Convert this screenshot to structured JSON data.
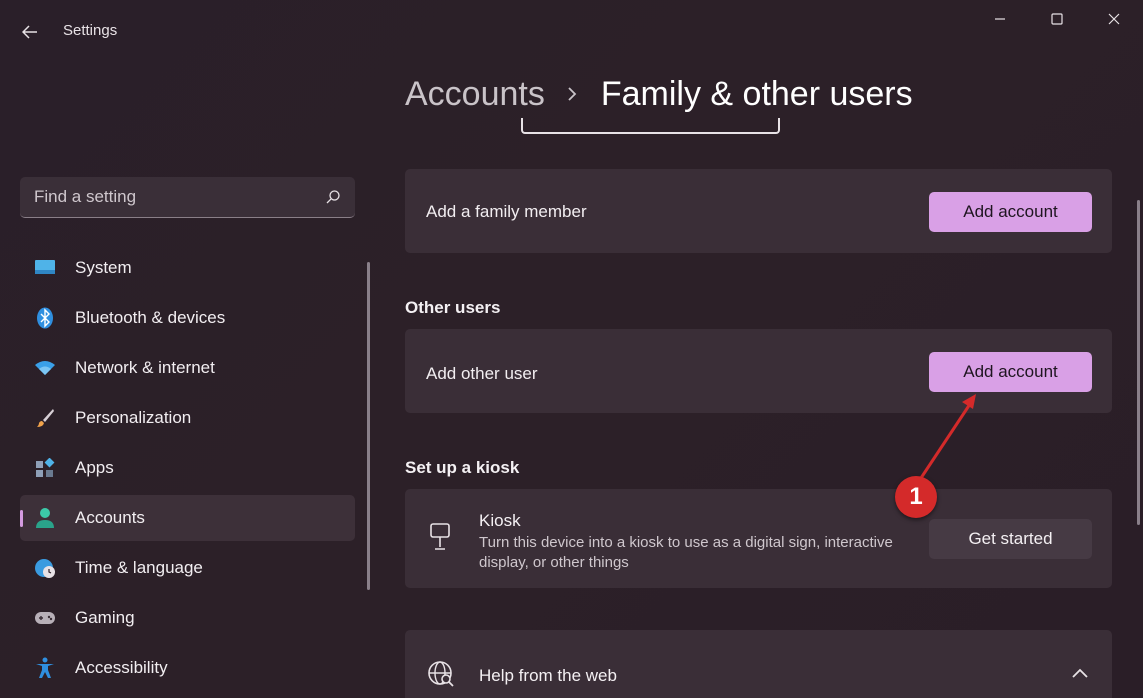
{
  "app": {
    "title": "Settings"
  },
  "search": {
    "placeholder": "Find a setting"
  },
  "sidebar": {
    "items": [
      {
        "label": "System",
        "icon": "monitor-icon"
      },
      {
        "label": "Bluetooth & devices",
        "icon": "bluetooth-icon"
      },
      {
        "label": "Network & internet",
        "icon": "wifi-icon"
      },
      {
        "label": "Personalization",
        "icon": "paintbrush-icon"
      },
      {
        "label": "Apps",
        "icon": "apps-icon"
      },
      {
        "label": "Accounts",
        "icon": "person-icon",
        "active": true
      },
      {
        "label": "Time & language",
        "icon": "globe-clock-icon"
      },
      {
        "label": "Gaming",
        "icon": "gamepad-icon"
      },
      {
        "label": "Accessibility",
        "icon": "accessibility-icon"
      }
    ]
  },
  "breadcrumb": {
    "parent": "Accounts",
    "current": "Family & other users"
  },
  "family": {
    "label": "Add a family member",
    "button": "Add account"
  },
  "other_users": {
    "section_title": "Other users",
    "label": "Add other user",
    "button": "Add account"
  },
  "kiosk": {
    "section_title": "Set up a kiosk",
    "title": "Kiosk",
    "description": "Turn this device into a kiosk to use as a digital sign, interactive display, or other things",
    "button": "Get started"
  },
  "help": {
    "label": "Help from the web"
  },
  "annotation": {
    "badge": "1",
    "color": "#d42a2a"
  },
  "colors": {
    "accent": "#d9a0e6",
    "background": "#2b2028",
    "card": "#3a2e37"
  }
}
